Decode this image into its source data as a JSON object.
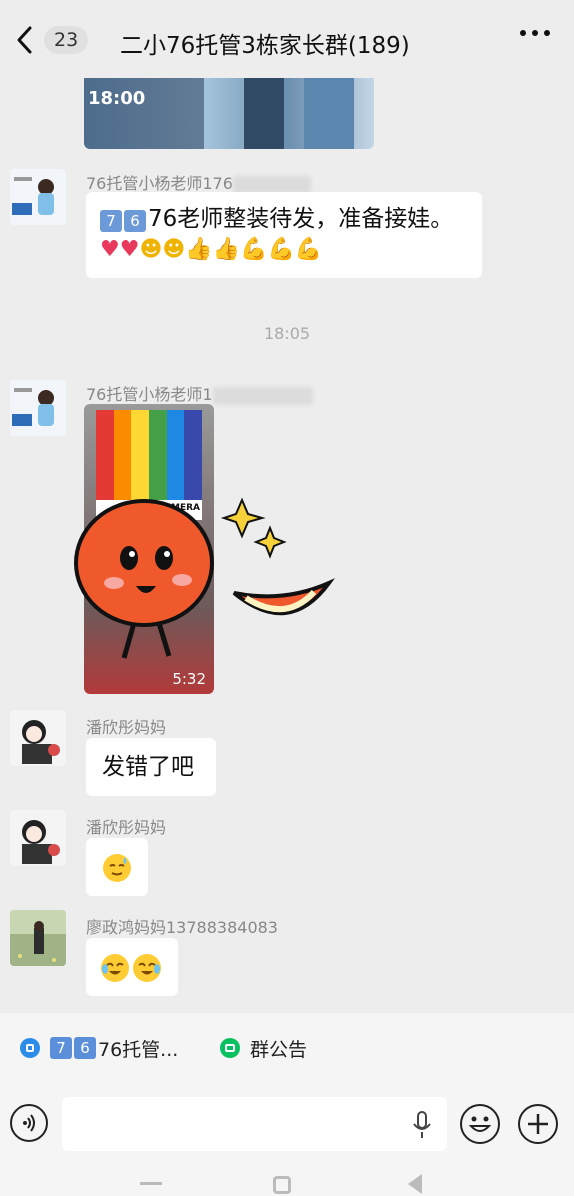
{
  "header": {
    "unread_count": "23",
    "title": "二小76托管3栋家长群(189)"
  },
  "messages": [
    {
      "sender": "76托管小杨老师176",
      "text": "76老师整装待发，准备接娃。"
    },
    {
      "timestamp": "18:05"
    },
    {
      "sender": "76托管小杨老师1",
      "video_brand": "MI CAMERA",
      "video_duration": "5:32"
    },
    {
      "sender": "潘欣彤妈妈",
      "text": "发错了吧"
    },
    {
      "sender": "潘欣彤妈妈"
    },
    {
      "sender": "廖政鸿妈妈13788384083"
    }
  ],
  "top_video": {
    "time_text": "18:00"
  },
  "bottom_links": {
    "group_link": "76托管...",
    "announcement": "群公告"
  },
  "colors": {
    "background": "#ededed",
    "bubble": "#ffffff",
    "accent": "#07c160"
  }
}
